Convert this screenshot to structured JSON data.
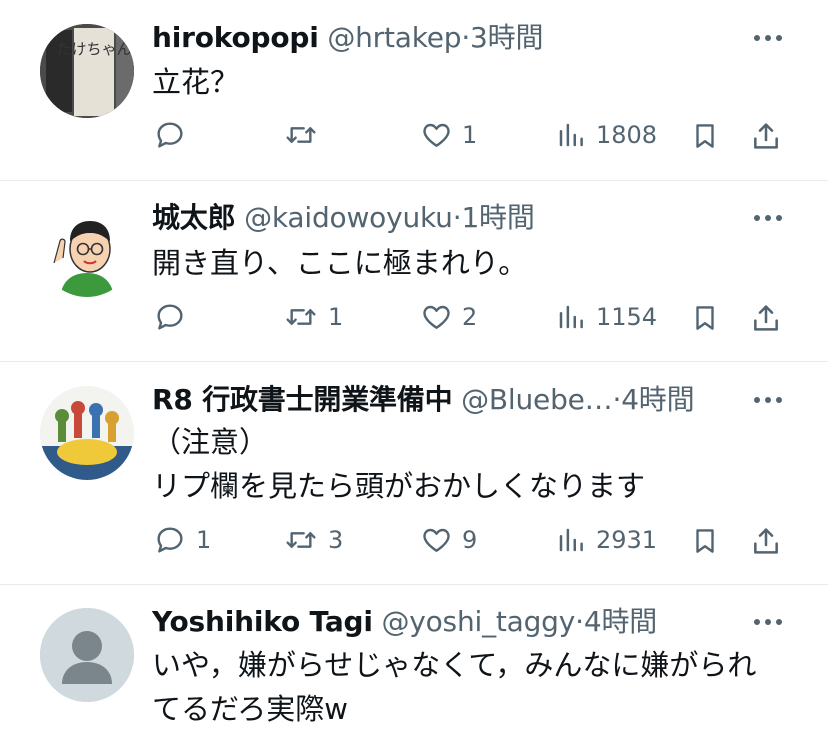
{
  "posts": [
    {
      "name": "hirokopopi",
      "handle": "@hrtakep",
      "dot": "·",
      "time": "3時間",
      "lines": [
        "立花？"
      ],
      "replies": "",
      "reposts": "",
      "likes": "1",
      "views": "1808",
      "avatar_text": "たけちゃん"
    },
    {
      "name": "城太郎",
      "handle": "@kaidowoyuku",
      "dot": "·",
      "time": "1時間",
      "lines": [
        "開き直り、ここに極まれり。"
      ],
      "replies": "",
      "reposts": "1",
      "likes": "2",
      "views": "1154"
    },
    {
      "name": "R8 行政書士開業準備中",
      "handle": "@Bluebe…",
      "dot": "·",
      "time": "4時間",
      "lines": [
        "（注意）",
        "リプ欄を見たら頭がおかしくなります"
      ],
      "replies": "1",
      "reposts": "3",
      "likes": "9",
      "views": "2931"
    },
    {
      "name": "Yoshihiko Tagi",
      "handle": "@yoshi_taggy",
      "dot": "·",
      "time": "4時間",
      "lines": [
        "いや，嫌がらせじゃなくて，みんなに嫌がられ",
        "てるだろ実際w"
      ]
    }
  ],
  "icons": {
    "reply": "reply-icon",
    "repost": "repost-icon",
    "like": "heart-icon",
    "views": "views-icon",
    "bookmark": "bookmark-icon",
    "share": "share-icon",
    "more": "more-icon"
  },
  "colors": {
    "text": "#0f1419",
    "secondary": "#536471",
    "divider": "#e7e9eb"
  }
}
